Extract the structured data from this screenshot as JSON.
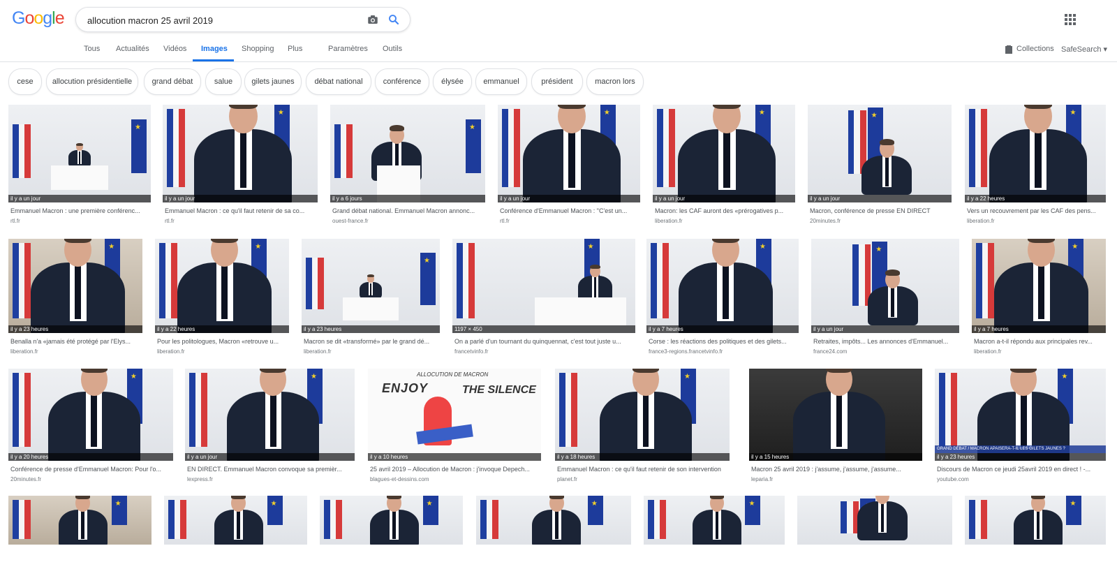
{
  "header": {
    "logo_letters": [
      {
        "ch": "G",
        "color": "#4285f4"
      },
      {
        "ch": "o",
        "color": "#ea4335"
      },
      {
        "ch": "o",
        "color": "#fbbc05"
      },
      {
        "ch": "g",
        "color": "#4285f4"
      },
      {
        "ch": "l",
        "color": "#34a853"
      },
      {
        "ch": "e",
        "color": "#ea4335"
      }
    ],
    "search_value": "allocution macron 25 avril 2019",
    "camera_icon": "camera-icon",
    "search_icon": "search-icon",
    "apps_icon": "apps-grid-icon"
  },
  "tabs": {
    "tous": "Tous",
    "actualites": "Actualités",
    "videos": "Vidéos",
    "images": "Images",
    "shopping": "Shopping",
    "plus": "Plus",
    "parametres": "Paramètres",
    "outils": "Outils",
    "collections": "Collections",
    "safesearch": "SafeSearch ▾"
  },
  "chips": {
    "c0": "cese",
    "c1": "allocution présidentielle",
    "c2": "grand débat",
    "c3": "salue",
    "c4": "gilets jaunes",
    "c5": "débat national",
    "c6": "conférence",
    "c7": "élysée",
    "c8": "emmanuel",
    "c9": "président",
    "c10": "macron lors"
  },
  "results": {
    "r1": {
      "time": "il y a un jour",
      "title": "Emmanuel Macron : une première conférenc...",
      "domain": "rtl.fr"
    },
    "r2": {
      "time": "il y a un jour",
      "title": "Emmanuel Macron : ce qu'il faut retenir de sa co...",
      "domain": "rtl.fr"
    },
    "r3": {
      "time": "il y a 6 jours",
      "title": "Grand débat national. Emmanuel Macron annonc...",
      "domain": "ouest-france.fr"
    },
    "r4": {
      "time": "il y a un jour",
      "title": "Conférence d'Emmanuel Macron : \"C'est un...",
      "domain": "rtl.fr"
    },
    "r5": {
      "time": "il y a un jour",
      "title": "Macron: les CAF auront des «prérogatives p...",
      "domain": "liberation.fr"
    },
    "r6": {
      "time": "il y a un jour",
      "title": "Macron, conférence de presse EN DIRECT",
      "domain": "20minutes.fr"
    },
    "r7": {
      "time": "il y a 22 heures",
      "title": "Vers un recouvrement par les CAF des pens...",
      "domain": "liberation.fr"
    },
    "r8": {
      "time": "il y a 23 heures",
      "title": "Benalla n'a «jamais été protégé par l'Elys...",
      "domain": "liberation.fr"
    },
    "r9": {
      "time": "il y a 22 heures",
      "title": "Pour les politologues, Macron «retrouve u...",
      "domain": "liberation.fr"
    },
    "r10": {
      "time": "il y a 23 heures",
      "title": "Macron se dit «transformé» par le grand dé...",
      "domain": "liberation.fr"
    },
    "r11": {
      "time": "1197 × 450",
      "title": "On a parlé d'un tournant du quinquennat, c'est tout juste u...",
      "domain": "francetvinfo.fr"
    },
    "r12": {
      "time": "il y a 7 heures",
      "title": "Corse : les réactions des politiques et des gilets...",
      "domain": "france3-regions.francetvinfo.fr"
    },
    "r13": {
      "time": "il y a un jour",
      "title": "Retraites, impôts... Les annonces d'Emmanuel...",
      "domain": "france24.com"
    },
    "r14": {
      "time": "il y a 7 heures",
      "title": "Macron a-t-il répondu aux principales rev...",
      "domain": "liberation.fr"
    },
    "r15": {
      "time": "il y a 20 heures",
      "title": "Conférence de presse d'Emmanuel Macron: Pour l'o...",
      "domain": "20minutes.fr"
    },
    "r16": {
      "time": "il y a un jour",
      "title": "EN DIRECT. Emmanuel Macron convoque sa premièr...",
      "domain": "lexpress.fr"
    },
    "r17": {
      "time": "il y a 10 heures",
      "title": "25 avril 2019 – Allocution de Macron : j'invoque Depech...",
      "domain": "blagues-et-dessins.com",
      "cartoon_top": "ALLOCUTION DE MACRON",
      "cartoon_left": "ENJOY",
      "cartoon_right": "THE SILENCE"
    },
    "r18": {
      "time": "il y a 18 heures",
      "title": "Emmanuel Macron : ce qu'il faut retenir de son intervention",
      "domain": "planet.fr"
    },
    "r19": {
      "time": "il y a 15 heures",
      "title": "Macron 25 avril 2019 : j'assume, j'assume, j'assume...",
      "domain": "leparia.fr"
    },
    "r20": {
      "time": "il y a 23 heures",
      "title": "Discours de Macron ce jeudi 25avril 2019 en direct ! -...",
      "domain": "youtube.com",
      "banner": "GRAND DÉBAT / MACRON APAISERA-T-IL LES GILETS JAUNES ?"
    }
  }
}
